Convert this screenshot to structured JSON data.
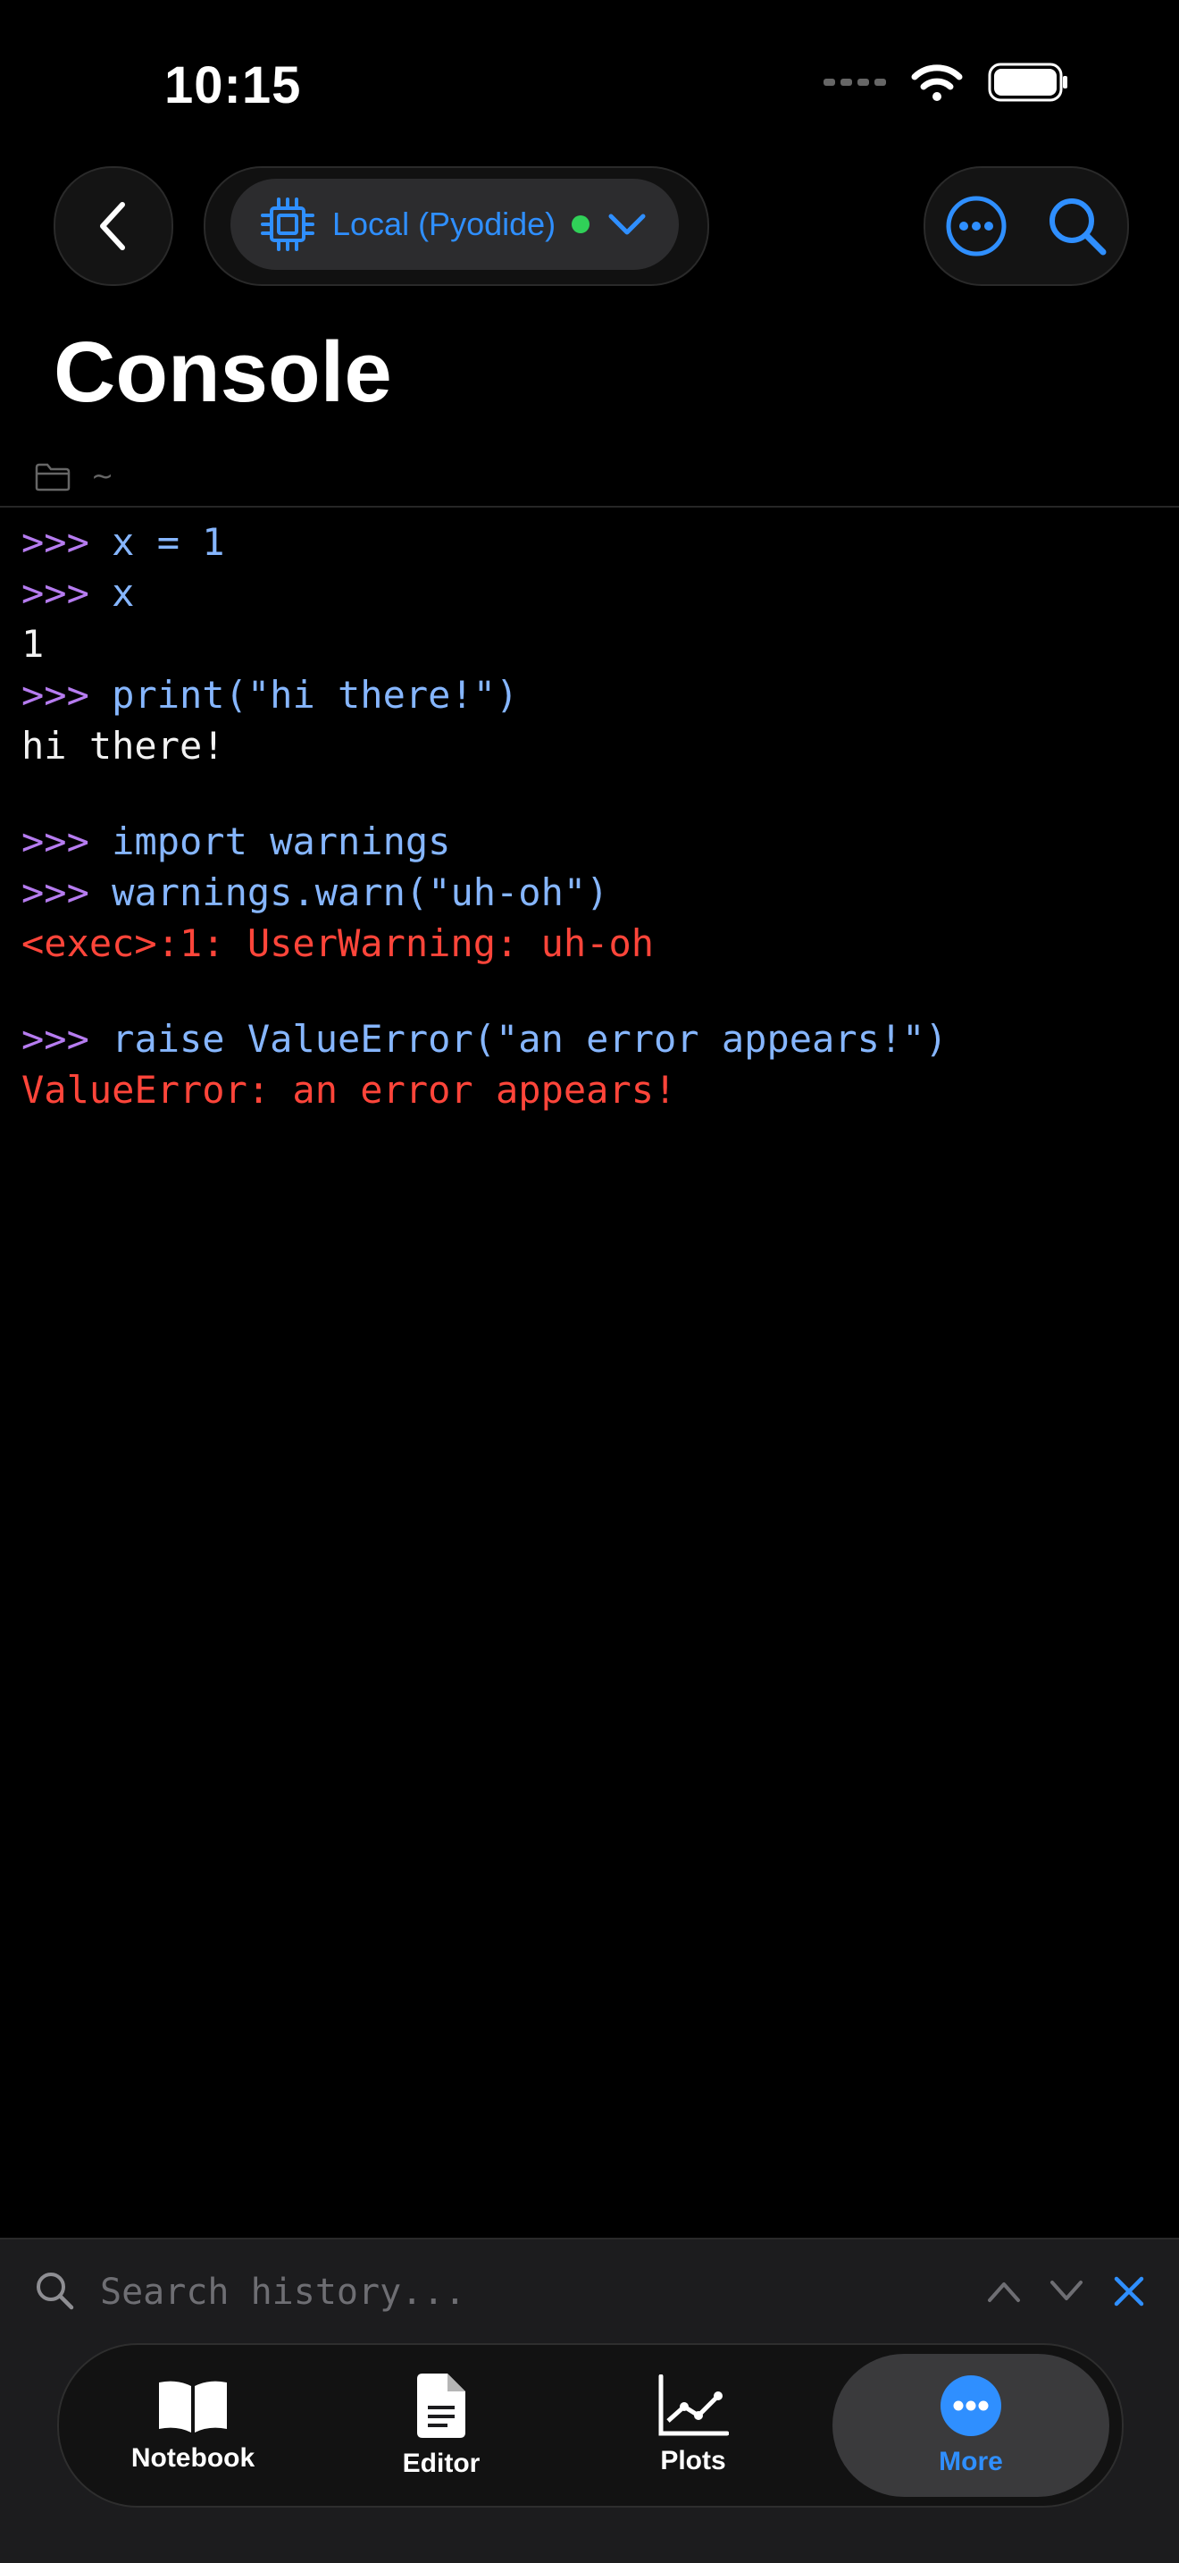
{
  "status": {
    "time": "10:15"
  },
  "toolbar": {
    "runtime_label": "Local (Pyodide)"
  },
  "page": {
    "title": "Console",
    "path": "~"
  },
  "console": {
    "blocks": [
      {
        "lines": [
          {
            "prompt": ">>> ",
            "code": "x = 1"
          },
          {
            "prompt": ">>> ",
            "code": "x"
          },
          {
            "output": "1"
          },
          {
            "prompt": ">>> ",
            "code": "print(\"hi there!\")"
          },
          {
            "output": "hi there!"
          }
        ]
      },
      {
        "lines": [
          {
            "prompt": ">>> ",
            "code": "import warnings"
          },
          {
            "prompt": ">>> ",
            "code": "warnings.warn(\"uh-oh\")"
          },
          {
            "error": "<exec>:1: UserWarning: uh-oh"
          }
        ]
      },
      {
        "lines": [
          {
            "prompt": ">>> ",
            "code": "raise ValueError(\"an error appears!\")"
          },
          {
            "error": "ValueError: an error appears!"
          }
        ]
      }
    ]
  },
  "search": {
    "placeholder": "Search history..."
  },
  "tabs": [
    {
      "label": "Notebook",
      "icon": "book-icon"
    },
    {
      "label": "Editor",
      "icon": "document-icon"
    },
    {
      "label": "Plots",
      "icon": "chart-icon"
    },
    {
      "label": "More",
      "icon": "ellipsis-icon",
      "active": true
    }
  ],
  "colors": {
    "accent": "#2f8fff",
    "prompt": "#b67cf0",
    "code": "#86b6ff",
    "error": "#ff453a",
    "status_dot": "#30d158"
  }
}
